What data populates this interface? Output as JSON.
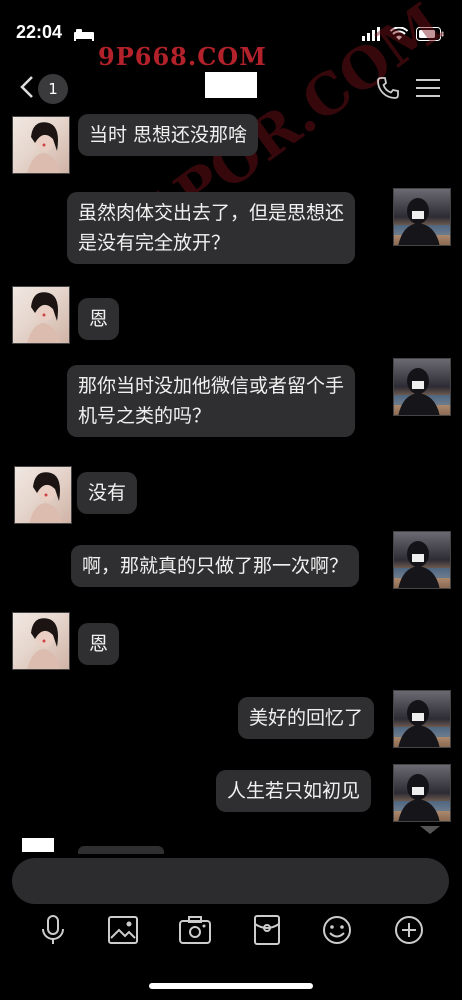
{
  "status_bar": {
    "time": "22:04"
  },
  "watermark": {
    "text": "9P668.COM",
    "diagonal": "91POR.COM"
  },
  "nav": {
    "back_count": "1",
    "title": ""
  },
  "messages": [
    {
      "side": "left",
      "text": "当时 思想还没那啥"
    },
    {
      "side": "right",
      "text": "虽然肉体交出去了，但是思想还\n是没有完全放开？"
    },
    {
      "side": "left",
      "text": "恩"
    },
    {
      "side": "right",
      "text": "那你当时没加他微信或者留个手\n机号之类的吗？"
    },
    {
      "side": "left",
      "text": "没有"
    },
    {
      "side": "right",
      "text": "啊，那就真的只做了那一次啊？"
    },
    {
      "side": "left",
      "text": "恩"
    },
    {
      "side": "right",
      "text": "美好的回忆了"
    },
    {
      "side": "right",
      "text": "人生若只如初见"
    }
  ],
  "input": {
    "placeholder": ""
  },
  "toolbar": {
    "icons": [
      "microphone-icon",
      "image-icon",
      "camera-icon",
      "red-packet-icon",
      "emoji-icon",
      "plus-icon"
    ]
  }
}
